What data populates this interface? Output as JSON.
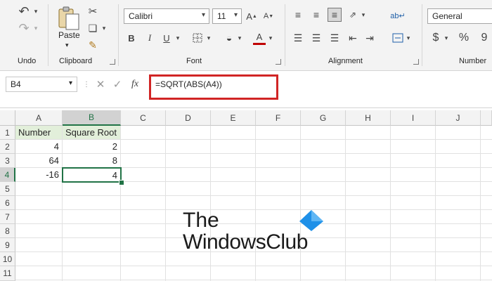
{
  "ribbon": {
    "groups": {
      "undo": "Undo",
      "clipboard": "Clipboard",
      "font": "Font",
      "alignment": "Alignment",
      "number": "Number"
    },
    "paste_label": "Paste",
    "font_name": "Calibri",
    "font_size": "11",
    "number_format": "General",
    "currency_symbol": "$",
    "percent_symbol": "%"
  },
  "formula_bar": {
    "name_box": "B4",
    "fx": "fx",
    "formula": "=SQRT(ABS(A4))"
  },
  "sheet": {
    "columns": [
      "A",
      "B",
      "C",
      "D",
      "E",
      "F",
      "G",
      "H",
      "I",
      "J"
    ],
    "rows": [
      "1",
      "2",
      "3",
      "4",
      "5",
      "6",
      "7",
      "8",
      "9",
      "10",
      "11"
    ],
    "cells": {
      "A1": "Number",
      "B1": "Square Root",
      "A2": "4",
      "B2": "2",
      "A3": "64",
      "B3": "8",
      "A4": "-16",
      "B4": "4"
    },
    "active_cell": "B4",
    "accent_color": "#217346"
  },
  "watermark": {
    "line1": "The",
    "line2": "WindowsClub",
    "logo_color": "#1e90e8"
  }
}
